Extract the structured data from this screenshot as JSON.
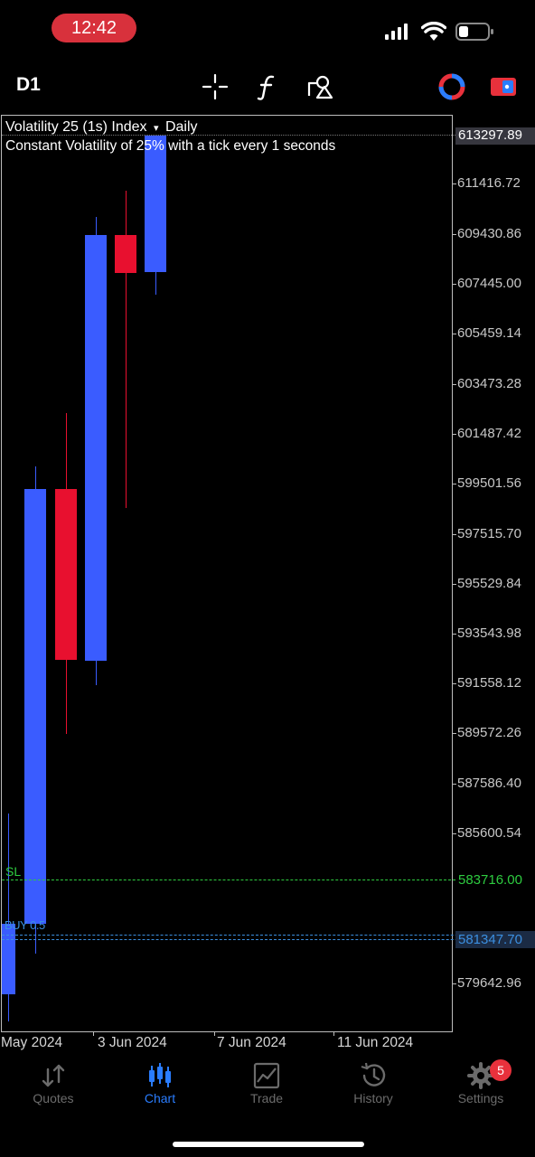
{
  "status_bar": {
    "time": "12:42"
  },
  "toolbar": {
    "timeframe": "D1",
    "icons": [
      "crosshair-icon",
      "function-icon",
      "objects-icon",
      "account-icon",
      "switch-icon"
    ]
  },
  "chart": {
    "symbol": "Volatility 25 (1s) Index",
    "dropdown_glyph": "▾",
    "period": "Daily",
    "description": "Constant Volatility of 25% with a tick every 1 seconds",
    "price_labels": [
      "611416.72",
      "609430.86",
      "607445.00",
      "605459.14",
      "603473.28",
      "601487.42",
      "599501.56",
      "597515.70",
      "595529.84",
      "593543.98",
      "591558.12",
      "589572.26",
      "587586.40",
      "585600.54",
      "579642.96"
    ],
    "current_price": "613297.89",
    "sl_label": "SL",
    "sl_price": "583716.00",
    "buy_label": "BUY 0.5",
    "buy_price": "581347.70",
    "dates": [
      "May 2024",
      "3 Jun 2024",
      "7 Jun 2024",
      "11 Jun 2024"
    ],
    "colors": {
      "bull": "#3a5cff",
      "bear": "#e8102f",
      "sl": "#2ecc40",
      "buy": "#3b8fe0"
    }
  },
  "tabs": [
    {
      "label": "Quotes",
      "icon": "quotes-icon",
      "active": false
    },
    {
      "label": "Chart",
      "icon": "chart-icon",
      "active": true
    },
    {
      "label": "Trade",
      "icon": "trade-icon",
      "active": false
    },
    {
      "label": "History",
      "icon": "history-icon",
      "active": false
    },
    {
      "label": "Settings",
      "icon": "settings-icon",
      "active": false
    }
  ],
  "settings_badge": "5"
}
